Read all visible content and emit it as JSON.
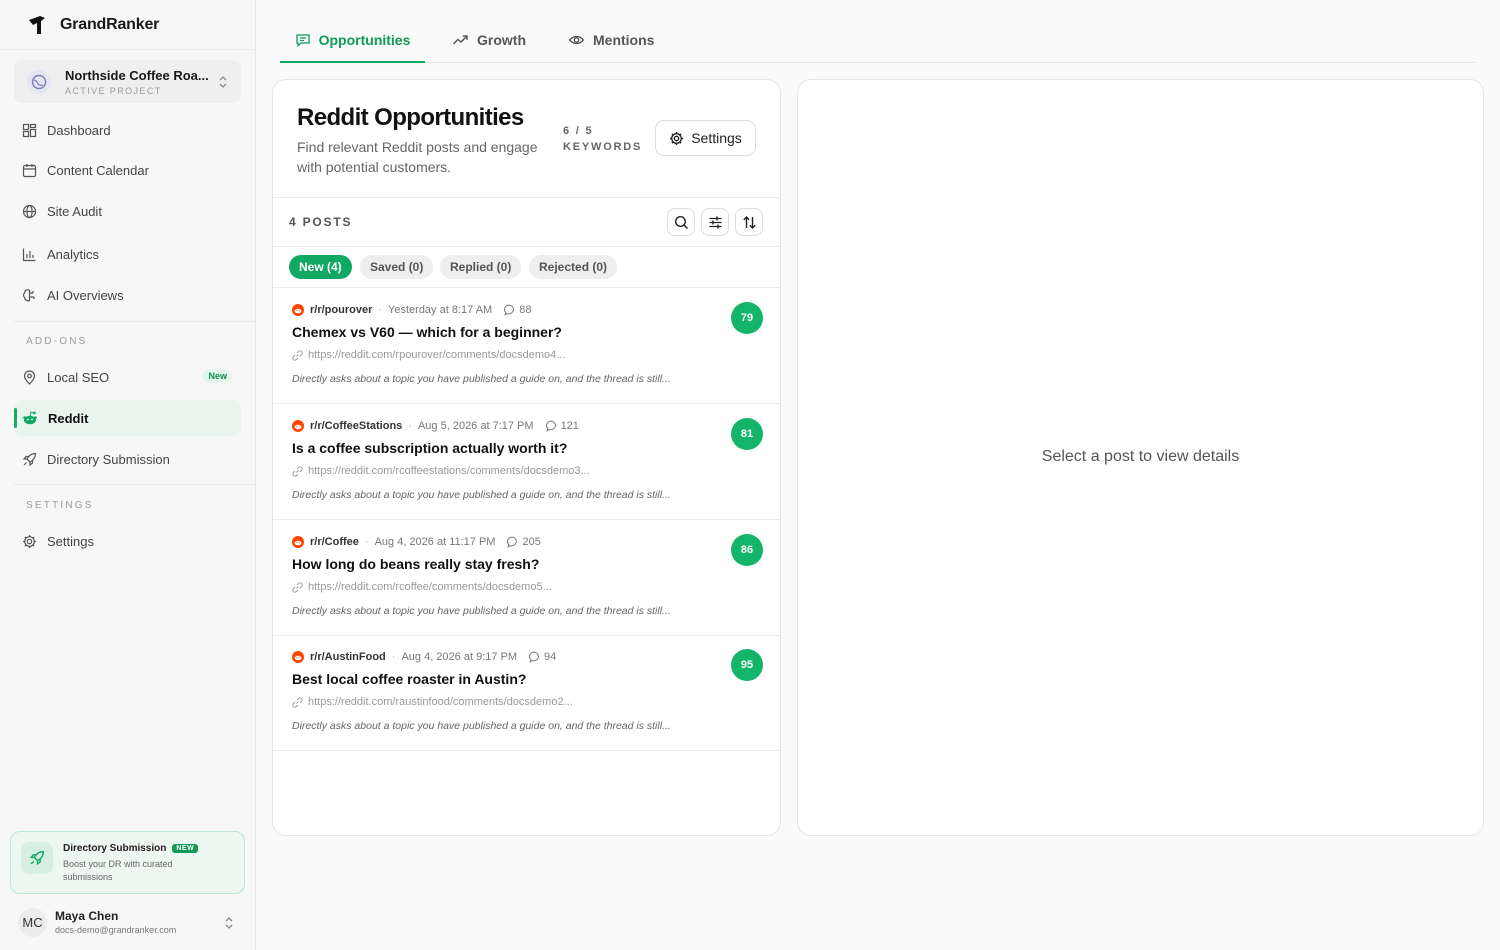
{
  "brand": {
    "name": "GrandRanker"
  },
  "project": {
    "name": "Northside Coffee Roa...",
    "label": "ACTIVE PROJECT"
  },
  "nav": {
    "dashboard": "Dashboard",
    "content_calendar": "Content Calendar",
    "site_audit": "Site Audit",
    "analytics": "Analytics",
    "ai_overviews": "AI Overviews",
    "addons_label": "ADD-ONS",
    "local_seo": "Local SEO",
    "local_seo_badge": "New",
    "reddit": "Reddit",
    "directory_submission": "Directory Submission",
    "settings_label": "SETTINGS",
    "settings": "Settings"
  },
  "promo": {
    "title": "Directory Submission",
    "badge": "NEW",
    "description": "Boost your DR with curated submissions"
  },
  "user": {
    "initials": "MC",
    "name": "Maya Chen",
    "email": "docs-demo@grandranker.com"
  },
  "tabs": [
    {
      "label": "Opportunities"
    },
    {
      "label": "Growth"
    },
    {
      "label": "Mentions"
    }
  ],
  "panel": {
    "title": "Reddit Opportunities",
    "description": "Find relevant Reddit posts and engage with potential customers.",
    "keywords_count": "6 / 5",
    "keywords_label": "KEYWORDS",
    "settings_button": "Settings",
    "posts_count": "4 POSTS",
    "filters": [
      {
        "label": "New (4)"
      },
      {
        "label": "Saved (0)"
      },
      {
        "label": "Replied (0)"
      },
      {
        "label": "Rejected (0)"
      }
    ],
    "posts": [
      {
        "subreddit": "r/r/pourover",
        "time": "Yesterday at 8:17 AM",
        "comments": "88",
        "title": "Chemex vs V60 — which for a beginner?",
        "url": "https://reddit.com/rpourover/comments/docsdemo4...",
        "reason": "Directly asks about a topic you have published a guide on, and the thread is still...",
        "score": "79"
      },
      {
        "subreddit": "r/r/CoffeeStations",
        "time": "Aug 5, 2026 at 7:17 PM",
        "comments": "121",
        "title": "Is a coffee subscription actually worth it?",
        "url": "https://reddit.com/rcoffeestations/comments/docsdemo3...",
        "reason": "Directly asks about a topic you have published a guide on, and the thread is still...",
        "score": "81"
      },
      {
        "subreddit": "r/r/Coffee",
        "time": "Aug 4, 2026 at 11:17 PM",
        "comments": "205",
        "title": "How long do beans really stay fresh?",
        "url": "https://reddit.com/rcoffee/comments/docsdemo5...",
        "reason": "Directly asks about a topic you have published a guide on, and the thread is still...",
        "score": "86"
      },
      {
        "subreddit": "r/r/AustinFood",
        "time": "Aug 4, 2026 at 9:17 PM",
        "comments": "94",
        "title": "Best local coffee roaster in Austin?",
        "url": "https://reddit.com/raustinfood/comments/docsdemo2...",
        "reason": "Directly asks about a topic you have published a guide on, and the thread is still...",
        "score": "95"
      }
    ]
  },
  "detail": {
    "empty_text": "Select a post to view details"
  },
  "colors": {
    "accent": "#10a862",
    "score": "#12b56a",
    "reddit": "#ff4500"
  }
}
